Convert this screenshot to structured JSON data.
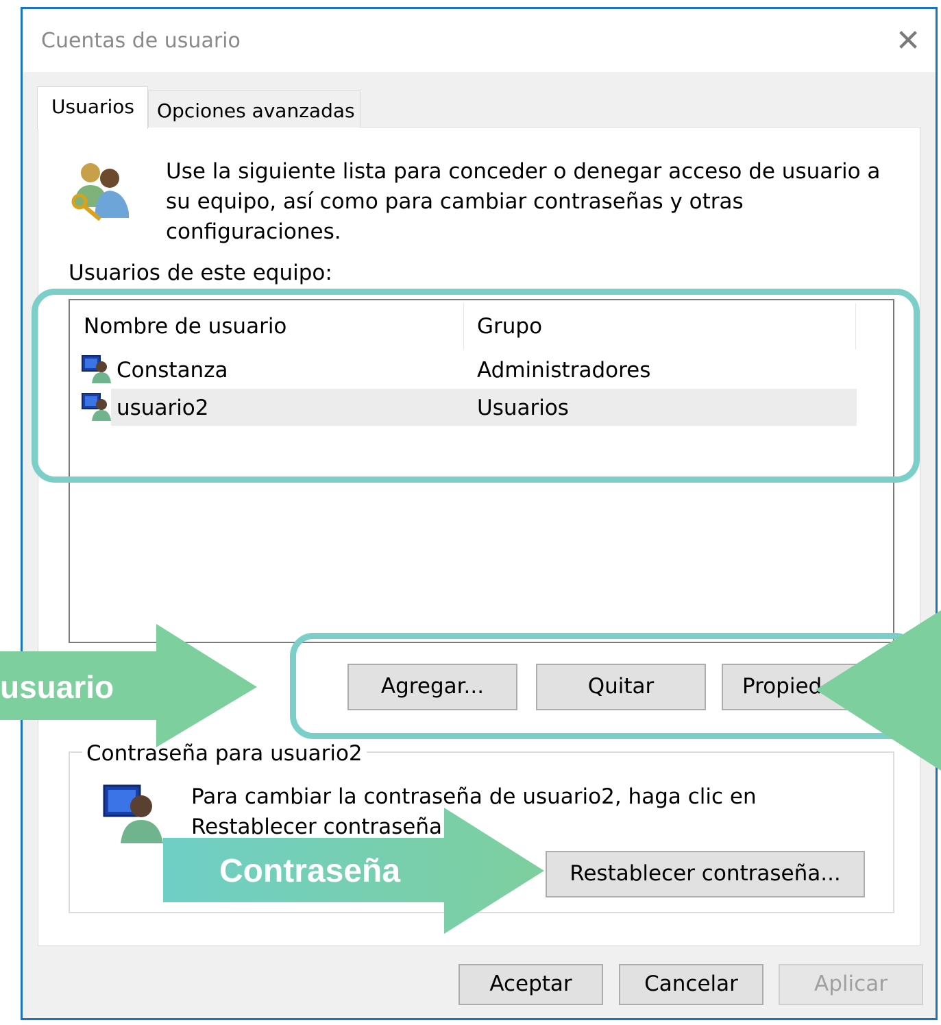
{
  "window": {
    "title": "Cuentas de usuario",
    "close_glyph": "✕"
  },
  "tabs": [
    {
      "label": "Usuarios",
      "selected": true
    },
    {
      "label": "Opciones avanzadas",
      "selected": false
    }
  ],
  "intro_text": "Use la siguiente lista para conceder o denegar acceso de usuario a su equipo, así como para cambiar contraseñas y otras configuraciones.",
  "users_list": {
    "label": "Usuarios de este equipo:",
    "columns": [
      "Nombre de usuario",
      "Grupo"
    ],
    "rows": [
      {
        "name": "Constanza",
        "group": "Administradores",
        "selected": false
      },
      {
        "name": "usuario2",
        "group": "Usuarios",
        "selected": true
      }
    ]
  },
  "list_buttons": {
    "add": "Agregar...",
    "remove": "Quitar",
    "properties": "Propied"
  },
  "password_group": {
    "legend": "Contraseña para usuario2",
    "text": "Para cambiar la contraseña de usuario2, haga clic en Restablecer contraseña.",
    "reset_button": "Restablecer contraseña..."
  },
  "footer_buttons": {
    "ok": "Aceptar",
    "cancel": "Cancelar",
    "apply": "Aplicar"
  },
  "annotations": {
    "callout_user": "usuario",
    "callout_password": "Contraseña",
    "highlight_color": "#7ccfc9",
    "arrow_color": "#7ecf9e"
  },
  "icons": [
    "users-keys-icon",
    "user-monitor-icon"
  ],
  "colors": {
    "window_border": "#1e73be",
    "dialog_bg": "#f0f0f0",
    "selected_row": "#ececec"
  }
}
